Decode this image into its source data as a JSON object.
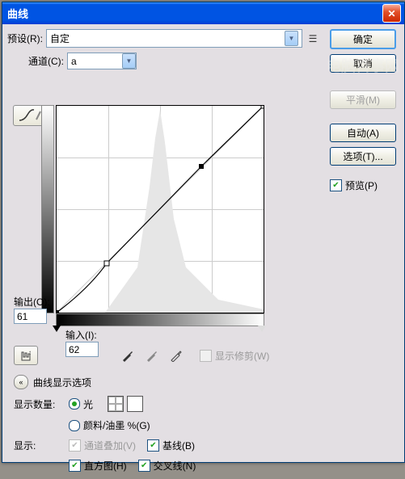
{
  "title": "曲线",
  "preset": {
    "label": "预设(R):",
    "value": "自定"
  },
  "channel": {
    "label": "通道(C):",
    "value": "a"
  },
  "buttons": {
    "ok": "确定",
    "cancel": "取消",
    "smooth": "平滑(M)",
    "auto": "自动(A)",
    "options": "选项(T)..."
  },
  "preview": {
    "checked": true,
    "label": "预览(P)"
  },
  "output": {
    "label": "输出(O):",
    "value": "61"
  },
  "input": {
    "label": "输入(I):",
    "value": "62"
  },
  "show_clip": "显示修剪(W)",
  "disclosure": "曲线显示选项",
  "display_qty": {
    "label": "显示数量:",
    "light": "光",
    "ink": "颜料/油墨 %(G)"
  },
  "show": {
    "label": "显示:",
    "channel_overlay": "通道叠加(V)",
    "baseline": "基线(B)",
    "histogram": "直方图(H)",
    "intersection": "交叉线(N)"
  },
  "brand": "电脑百事网",
  "chart_data": {
    "type": "line",
    "xlim": [
      0,
      255
    ],
    "ylim": [
      0,
      255
    ],
    "points": [
      [
        0,
        0
      ],
      [
        62,
        61
      ],
      [
        179,
        181
      ],
      [
        255,
        255
      ]
    ],
    "histogram_peak": 128
  }
}
